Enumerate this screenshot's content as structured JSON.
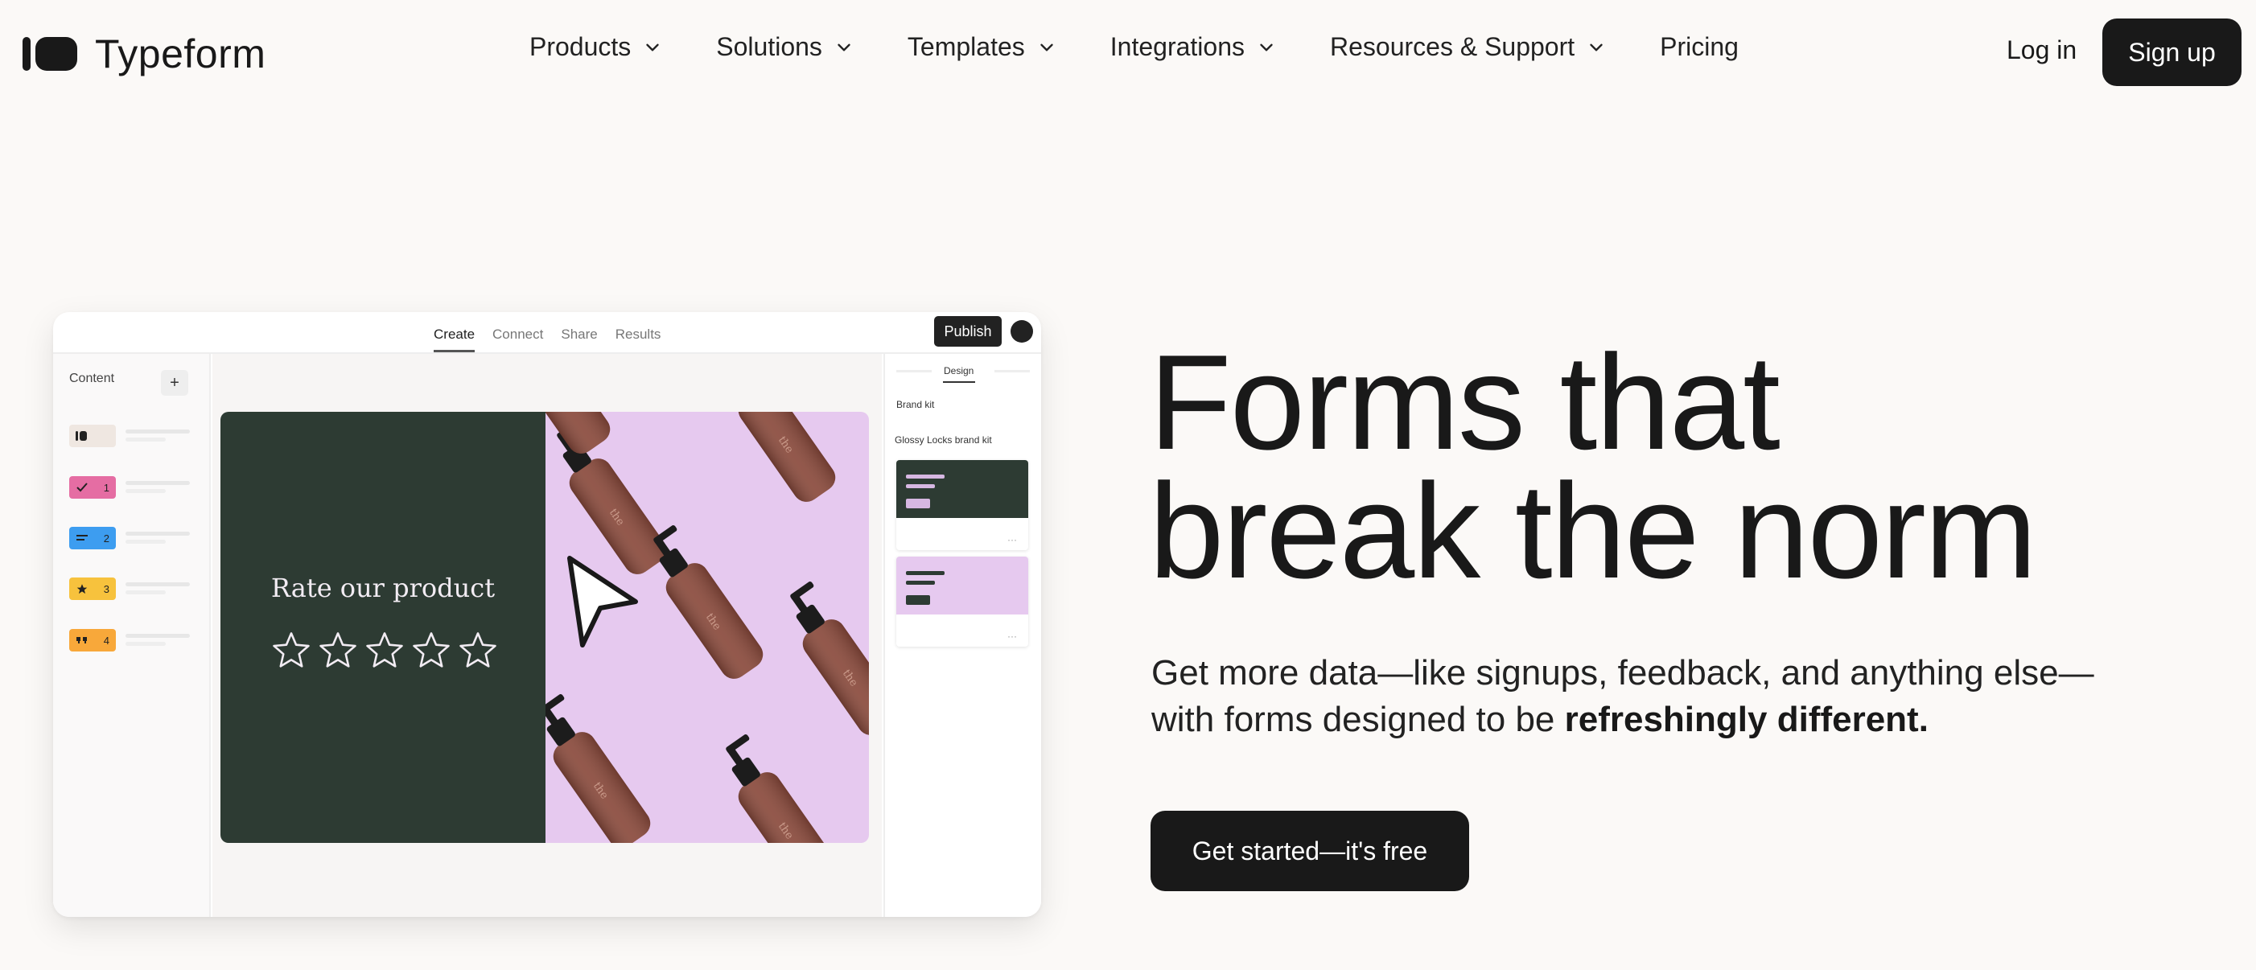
{
  "brand": {
    "name": "Typeform"
  },
  "nav": {
    "items": [
      {
        "label": "Products",
        "dropdown": true
      },
      {
        "label": "Solutions",
        "dropdown": true
      },
      {
        "label": "Templates",
        "dropdown": true
      },
      {
        "label": "Integrations",
        "dropdown": true
      },
      {
        "label": "Resources & Support",
        "dropdown": true
      },
      {
        "label": "Pricing",
        "dropdown": false
      }
    ],
    "login_label": "Log in",
    "signup_label": "Sign up"
  },
  "mockup": {
    "tabs": [
      "Create",
      "Connect",
      "Share",
      "Results"
    ],
    "active_tab": "Create",
    "publish_label": "Publish",
    "content_label": "Content",
    "add_label": "+",
    "questions": [
      {
        "number": "",
        "icon": "welcome-icon",
        "color": "#efe7e1"
      },
      {
        "number": "1",
        "icon": "check-icon",
        "color": "#e56da3"
      },
      {
        "number": "2",
        "icon": "list-icon",
        "color": "#3d9df0"
      },
      {
        "number": "3",
        "icon": "star-icon",
        "color": "#f7c23d"
      },
      {
        "number": "4",
        "icon": "quote-icon",
        "color": "#f8a83a"
      }
    ],
    "card_heading": "Rate our product",
    "rating_stars": 5,
    "design_tab": "Design",
    "brand_kit_label": "Brand kit",
    "brand_kit_name": "Glossy Locks brand kit",
    "more_label": "···",
    "colors": {
      "green": "#2d3b33",
      "purple": "#e6c9ef",
      "bottle": "#8a4a3c"
    }
  },
  "hero": {
    "title_line1": "Forms that",
    "title_line2": "break the norm",
    "subtitle_start": "Get more data—like signups, feedback, and anything else—with forms designed to be ",
    "subtitle_bold": "refreshingly different.",
    "cta_label": "Get started—it's free"
  }
}
